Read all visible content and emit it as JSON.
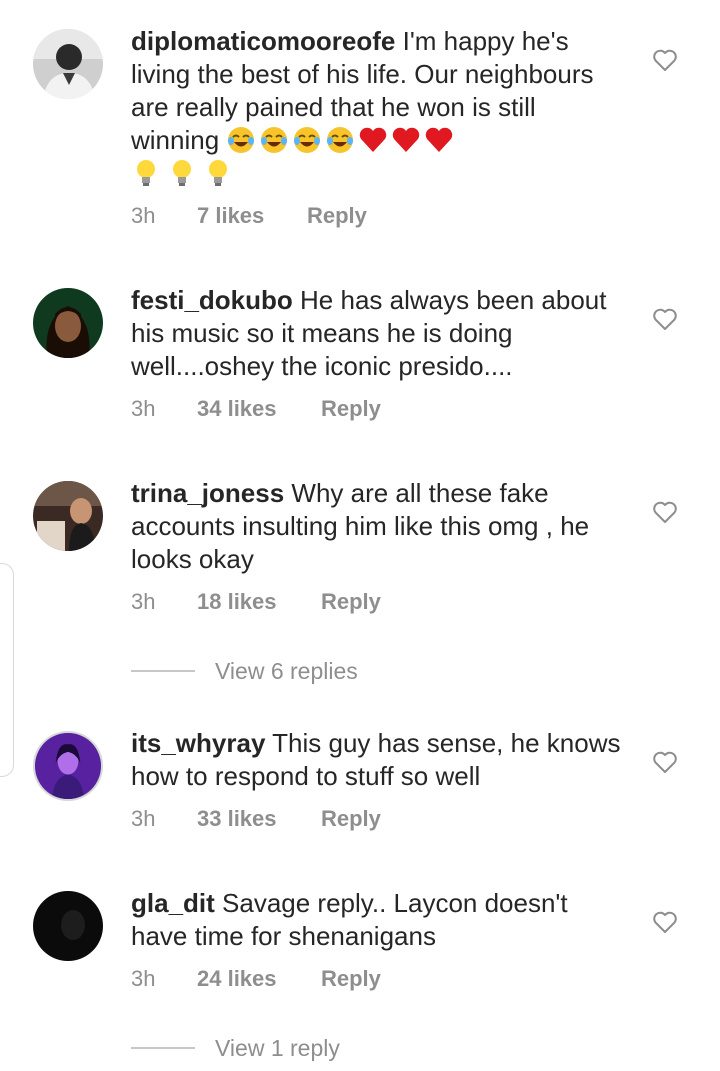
{
  "comments": [
    {
      "username": "diplomaticomooreofe",
      "text": "I'm happy he's living the best of his life. Our neighbours are really pained that he won is still winning",
      "trailing_emojis": [
        "joy-face",
        "joy-face",
        "joy-face",
        "joy-face",
        "red-heart",
        "red-heart",
        "red-heart",
        "light-bulb",
        "light-bulb",
        "light-bulb"
      ],
      "time": "3h",
      "likes": "7 likes",
      "reply": "Reply"
    },
    {
      "username": "festi_dokubo",
      "text": "He has always been about his music so it means he is doing well....oshey the iconic presido....",
      "time": "3h",
      "likes": "34 likes",
      "reply": "Reply"
    },
    {
      "username": "trina_joness",
      "text": "Why are all these fake accounts insulting him like this omg , he looks okay",
      "time": "3h",
      "likes": "18 likes",
      "reply": "Reply",
      "view_replies": "View 6 replies"
    },
    {
      "username": "its_whyray",
      "text": "This guy has sense, he knows how to respond to stuff so well",
      "time": "3h",
      "likes": "33 likes",
      "reply": "Reply"
    },
    {
      "username": "gla_dit",
      "text": "Savage reply.. Laycon doesn't have time for shenanigans",
      "time": "3h",
      "likes": "24 likes",
      "reply": "Reply",
      "view_replies": "View 1 reply"
    }
  ],
  "icons": {
    "like": "heart-outline-icon"
  },
  "colors": {
    "text": "#262626",
    "meta": "#8e8e8e",
    "divider": "#c7c7c7"
  }
}
